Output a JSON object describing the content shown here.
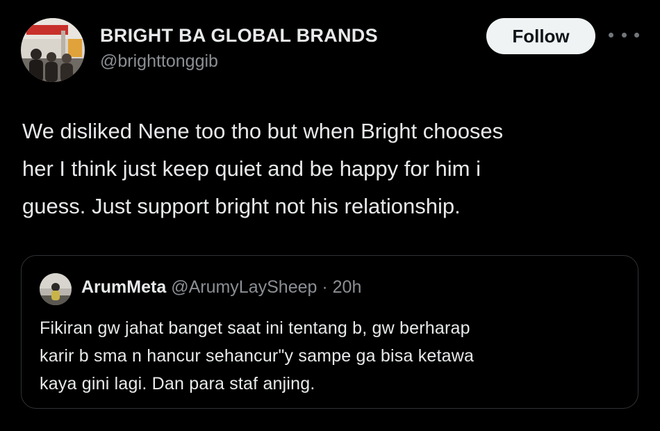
{
  "author": {
    "display_name": "BRIGHT BA GLOBAL BRANDS",
    "handle": "@brighttonggib",
    "avatar_icon": "group-photo-avatar"
  },
  "actions": {
    "follow_label": "Follow",
    "more_icon": "more-horizontal-icon"
  },
  "tweet": {
    "lines": [
      "We disliked Nene too tho but when Bright chooses",
      "her I think just keep quiet and be happy for him i",
      "guess. Just support bright not his relationship."
    ]
  },
  "quote": {
    "display_name": "ArumMeta",
    "handle": "@ArumyLaySheep",
    "separator": "·",
    "time": "20h",
    "avatar_icon": "small-figure-avatar",
    "lines": [
      "Fikiran gw jahat banget saat ini tentang b, gw berharap",
      "karir b sma n hancur sehancur\"y sampe ga bisa ketawa",
      "kaya gini lagi. Dan para staf anjing."
    ]
  },
  "colors": {
    "background": "#000000",
    "text_primary": "#e7e9ea",
    "text_secondary": "#8b8f94",
    "follow_bg": "#eff3f4",
    "border": "#2f3336"
  }
}
